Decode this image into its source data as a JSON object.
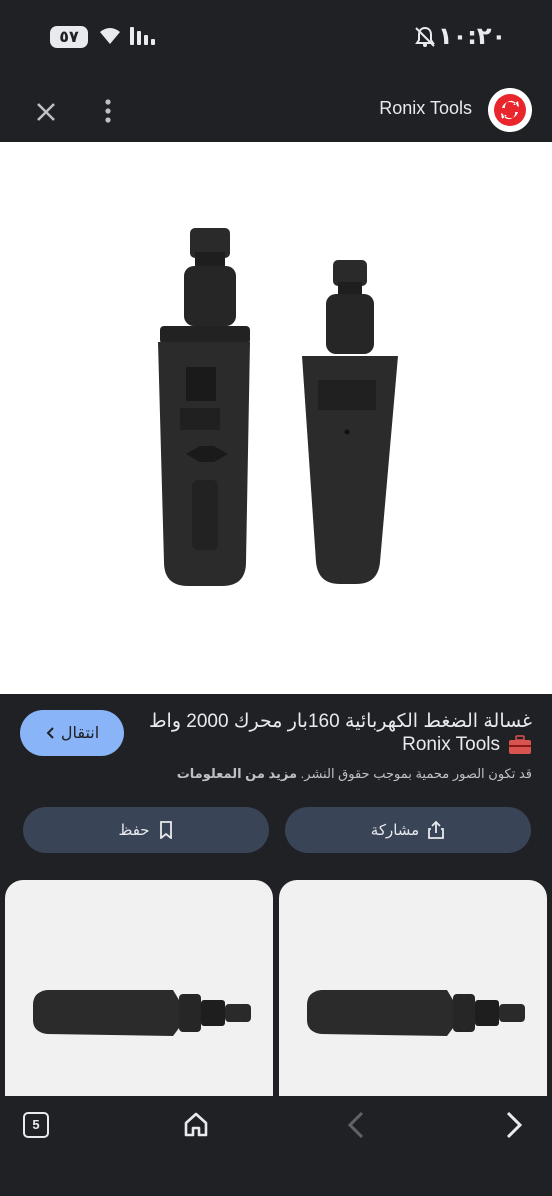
{
  "status_bar": {
    "time": "١٠:٢٠",
    "battery": "٥٧"
  },
  "header": {
    "site_name": "Ronix Tools",
    "icons": [
      "close-icon",
      "more-vert-icon",
      "ronix-logo"
    ]
  },
  "result": {
    "title": "غسالة الضغط الكهربائية 160بار محرك 2000 واط ا",
    "source": "Ronix Tools",
    "visit_label": "انتقال",
    "notice_prefix": "قد تكون الصور محمية بموجب حقوق النشر.",
    "notice_link": "مزيد من المعلومات",
    "share_label": "مشاركة",
    "save_label": "حفظ"
  },
  "bottom_nav": {
    "tab_count": "5",
    "icons": [
      "tabs-icon",
      "home-icon",
      "back-arrow-icon",
      "forward-arrow-icon"
    ]
  },
  "colors": {
    "background": "#202124",
    "accent": "#8ab4f8",
    "button_bg": "#394457",
    "logo_red": "#e8262b"
  }
}
